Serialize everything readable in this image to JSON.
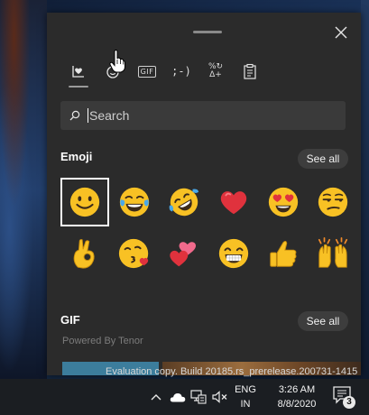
{
  "panel": {
    "tabs": [
      {
        "name": "emoji-tab",
        "label": ""
      },
      {
        "name": "kaomoji-people-tab",
        "label": ""
      },
      {
        "name": "gif-tab",
        "label": "GIF"
      },
      {
        "name": "kaomoji-tab",
        "label": ";-)"
      },
      {
        "name": "symbols-tab",
        "label_top": "%↻",
        "label_bottom": "Δ+"
      },
      {
        "name": "clipboard-tab",
        "label": ""
      }
    ],
    "search_placeholder": "Search",
    "emoji_section": {
      "title": "Emoji",
      "see_all": "See all"
    },
    "emojis": [
      "slightly-smiling-face",
      "face-with-tears-of-joy",
      "rolling-on-floor-laughing",
      "red-heart",
      "smiling-face-with-heart-eyes",
      "unamused-face",
      "ok-hand",
      "face-blowing-a-kiss",
      "two-hearts",
      "beaming-face",
      "thumbs-up",
      "raising-hands"
    ],
    "gif_section": {
      "title": "GIF",
      "see_all": "See all",
      "powered_by": "Powered By Tenor"
    }
  },
  "watermark": "Evaluation copy. Build 20185.rs_prerelease.200731-1415",
  "taskbar": {
    "language_top": "ENG",
    "language_bottom": "IN",
    "time": "3:26 AM",
    "date": "8/8/2020",
    "notification_count": "3"
  },
  "colors": {
    "panel_bg": "#2b2b2b",
    "search_bg": "#3a3a3a",
    "pill_bg": "#3d3d3d",
    "taskbar_bg": "#1b1e22",
    "emoji_yellow": "#f8c124",
    "heart_red": "#e0323d"
  }
}
